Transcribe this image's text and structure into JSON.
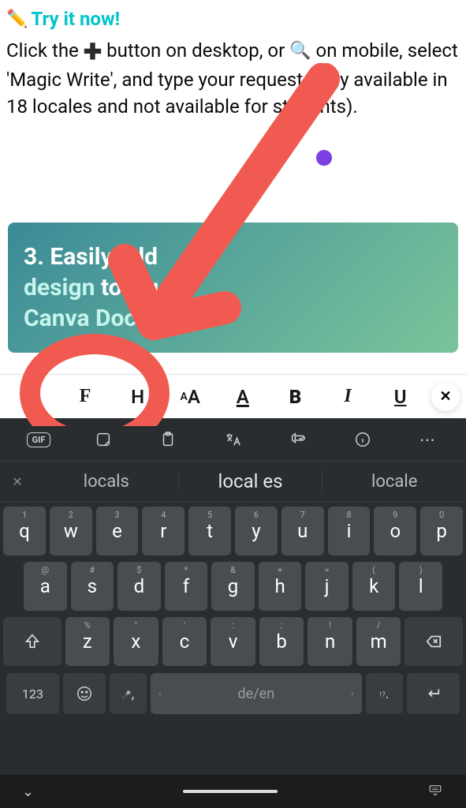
{
  "heading": {
    "emoji": "✏️",
    "text": "Try it now!"
  },
  "body": {
    "part1": "Click the ",
    "part2": " button on desktop, or ",
    "part3": " on mobile, select 'Magic Write', and type your request (only available in 18 locales and not available for students)."
  },
  "card": {
    "num": "3. ",
    "t1": "Easily add",
    "t2": "design",
    "t3": " to your",
    "t4": "Canva Doc"
  },
  "toolbar": {
    "h_label": "H",
    "aa_small": "A",
    "aa_big": "A",
    "color_a": "A",
    "bold": "B",
    "italic": "I",
    "underline": "U"
  },
  "keyboard": {
    "suggestions": [
      "locals",
      "local es",
      "locale"
    ],
    "row1": [
      {
        "n": "1",
        "l": "q"
      },
      {
        "n": "2",
        "l": "w"
      },
      {
        "n": "3",
        "l": "e"
      },
      {
        "n": "4",
        "l": "r"
      },
      {
        "n": "5",
        "l": "t"
      },
      {
        "n": "6",
        "l": "y"
      },
      {
        "n": "7",
        "l": "u"
      },
      {
        "n": "8",
        "l": "i"
      },
      {
        "n": "9",
        "l": "o"
      },
      {
        "n": "0",
        "l": "p"
      }
    ],
    "row2": [
      {
        "n": "@",
        "l": "a"
      },
      {
        "n": "#",
        "l": "s"
      },
      {
        "n": "$",
        "l": "d"
      },
      {
        "n": "*",
        "l": "f"
      },
      {
        "n": "&",
        "l": "g"
      },
      {
        "n": "+",
        "l": "h"
      },
      {
        "n": "=",
        "l": "j"
      },
      {
        "n": "(",
        "l": "k"
      },
      {
        "n": ")",
        "l": "l"
      }
    ],
    "row3": [
      {
        "n": "%",
        "l": "z"
      },
      {
        "n": "\"",
        "l": "x"
      },
      {
        "n": "'",
        "l": "c"
      },
      {
        "n": ":",
        "l": "v"
      },
      {
        "n": ";",
        "l": "b"
      },
      {
        "n": "!",
        "l": "n"
      },
      {
        "n": "/",
        "l": "m"
      }
    ],
    "bottom": {
      "num_label": "123",
      "comma_hint": "🎤",
      "comma": ",",
      "space": "de/en",
      "period_hint": "!?",
      "period": "."
    }
  },
  "colors": {
    "accent_teal": "#00c4cc",
    "purple": "#7b3fe4",
    "annotation_red": "#f15a50"
  }
}
